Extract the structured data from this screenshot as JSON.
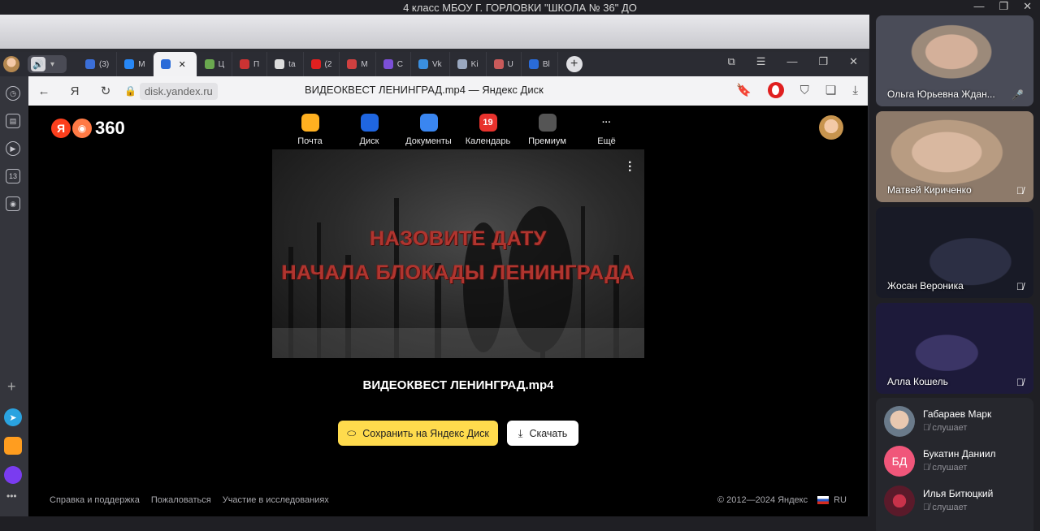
{
  "window": {
    "title": "4 класс МБОУ Г. ГОРЛОВКИ \"ШКОЛА № 36\" ДО"
  },
  "browser": {
    "tabs": [
      {
        "label": "(3)",
        "icon": "mail-icon",
        "color": "#3b6fd8"
      },
      {
        "label": "M",
        "icon": "vk-icon",
        "color": "#2787f5"
      },
      {
        "label": "",
        "icon": "yandex-disk-icon",
        "color": "#2a6bd8",
        "active": true
      },
      {
        "label": "Ц",
        "icon": "cube-icon",
        "color": "#6aa84f"
      },
      {
        "label": "П",
        "icon": "flag-icon",
        "color": "#cc3333"
      },
      {
        "label": "ta",
        "icon": "doc-icon",
        "color": "#dddddd"
      },
      {
        "label": "(2",
        "icon": "youtube-icon",
        "color": "#e02020"
      },
      {
        "label": "M",
        "icon": "mail-ru-icon",
        "color": "#d04040"
      },
      {
        "label": "C",
        "icon": "orb-icon",
        "color": "#7b4fd6"
      },
      {
        "label": "Vk",
        "icon": "shield-icon",
        "color": "#3a8fe0"
      },
      {
        "label": "Ki",
        "icon": "globe-icon",
        "color": "#9aa8c0"
      },
      {
        "label": "U",
        "icon": "image-icon",
        "color": "#c85a5a"
      },
      {
        "label": "Bl",
        "icon": "disk-icon",
        "color": "#2a6bd8"
      }
    ],
    "url": "disk.yandex.ru",
    "page_title": "ВИДЕОКВЕСТ ЛЕНИНГРАД.mp4 — Яндекс Диск"
  },
  "page": {
    "logo_text": "360",
    "logo_letter": "Я",
    "services": [
      {
        "label": "Почта",
        "icon": "mail-envelope-icon",
        "color": "#ffb020",
        "glyph": ""
      },
      {
        "label": "Диск",
        "icon": "disk-cloud-icon",
        "color": "#1f66e0",
        "glyph": ""
      },
      {
        "label": "Документы",
        "icon": "documents-icon",
        "color": "#3a86f0",
        "glyph": ""
      },
      {
        "label": "Календарь",
        "icon": "calendar-icon",
        "color": "#e8322d",
        "glyph": "19"
      },
      {
        "label": "Премиум",
        "icon": "premium-icon",
        "color": "#555555",
        "glyph": ""
      },
      {
        "label": "Ещё",
        "icon": "more-dots-icon",
        "color": "#000000",
        "glyph": "···"
      }
    ],
    "video_line1": "НАЗОВИТЕ ДАТУ",
    "video_line2": "НАЧАЛА БЛОКАДЫ ЛЕНИНГРАДА",
    "file_name": "ВИДЕОКВЕСТ ЛЕНИНГРАД.mp4",
    "save_label": "Сохранить на Яндекс Диск",
    "download_label": "Скачать",
    "footer_links": [
      "Справка и поддержка",
      "Пожаловаться",
      "Участие в исследованиях"
    ],
    "copyright": "© 2012—2024 Яндекс",
    "lang": "RU",
    "accent_yellow": "#ffdb4d"
  },
  "participants_video": [
    {
      "name": "Ольга Юрьевна Ждан...",
      "mic": "mic-on"
    },
    {
      "name": "Матвей Кириченко",
      "mic": "mic-off"
    },
    {
      "name": "Жосан Вероника",
      "mic": "mic-off"
    },
    {
      "name": "Алла Кошель",
      "mic": "mic-off"
    }
  ],
  "participants_list": [
    {
      "name": "Габараев Марк",
      "status": "слушает",
      "initials": ""
    },
    {
      "name": "Букатин Даниил",
      "status": "слушает",
      "initials": "БД"
    },
    {
      "name": "Илья Битюцкий",
      "status": "слушает",
      "initials": ""
    }
  ]
}
